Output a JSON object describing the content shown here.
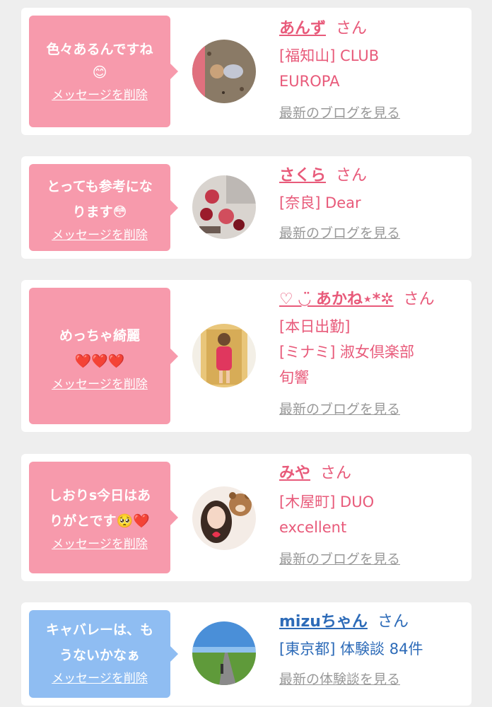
{
  "delete_label": "メッセージを削除",
  "suffix": "さん",
  "colors": {
    "pink": "#e85a7a",
    "bubble_pink": "#f79aac",
    "bubble_blue": "#8fbdf2",
    "blue": "#2d6bb8"
  },
  "items": [
    {
      "message_line1": "色々あるんですね",
      "message_line2": "😊",
      "name": "あんず",
      "shop_line1": "[福知山] CLUB",
      "shop_line2": "EUROPA",
      "link": "最新のブログを見る"
    },
    {
      "message_line1": "とっても参考にな",
      "message_line2": "ります😳",
      "name": "さくら",
      "shop_line1": "[奈良] Dear",
      "link": "最新のブログを見る"
    },
    {
      "message_line1": "めっちゃ綺麗",
      "message_line2": "❤️❤️❤️",
      "name": "♡ ◡̈ あかね⋆*✲",
      "shop_line1": "[本日出勤]",
      "shop_line2": "[ミナミ] 淑女倶楽部",
      "shop_line3": "旬響",
      "link": "最新のブログを見る"
    },
    {
      "message_line1": "しおりs今日はあ",
      "message_line2": "りがとです🥺❤️",
      "name": "みや",
      "shop_line1": "[木屋町] DUO",
      "shop_line2": "excellent",
      "link": "最新のブログを見る"
    },
    {
      "message_line1": "キャバレーは、も",
      "message_line2": "うないかなぁ",
      "name": "mizuちゃん",
      "shop_line1": "[東京都] 体験談 84件",
      "link": "最新の体験談を見る"
    }
  ]
}
